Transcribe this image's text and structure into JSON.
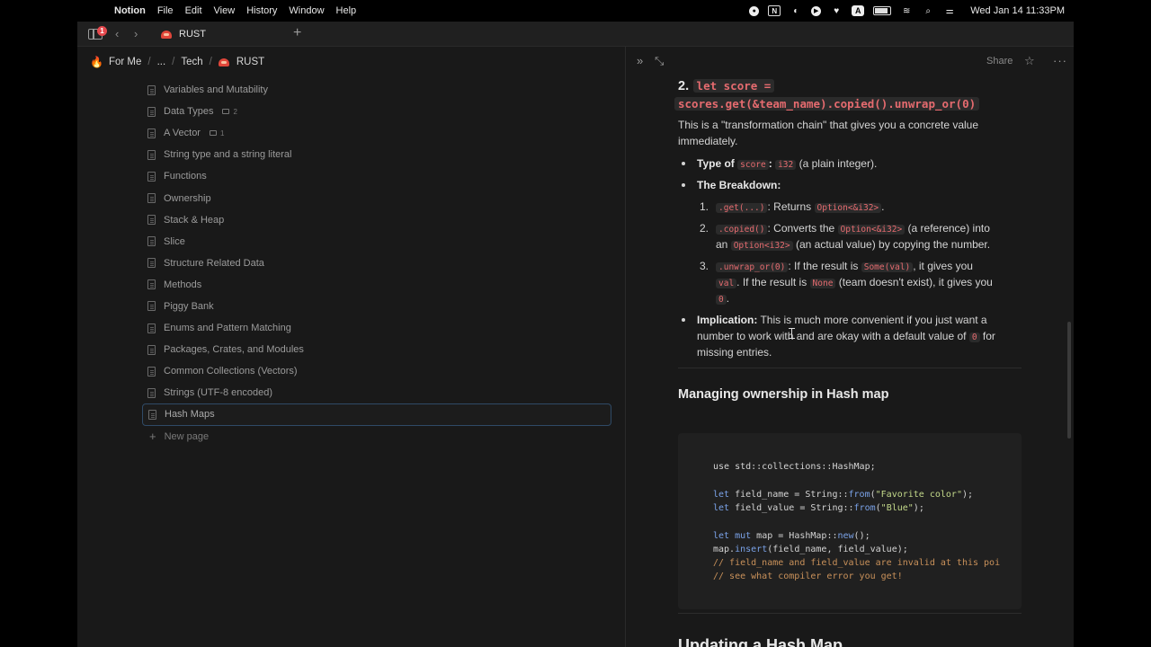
{
  "menubar": {
    "app_name": "Notion",
    "items": [
      "File",
      "Edit",
      "View",
      "History",
      "Window",
      "Help"
    ],
    "clock": "Wed Jan 14  11:33PM",
    "status_icons": [
      "record-icon",
      "notion-icon",
      "half-circle-icon",
      "play-icon",
      "heart-icon",
      "a-icon",
      "battery-icon",
      "wifi-icon",
      "search-icon",
      "control-center-icon"
    ]
  },
  "tabbar": {
    "notification_count": "1",
    "tab_title": "RUST"
  },
  "breadcrumb": {
    "items": [
      "For Me",
      "...",
      "Tech",
      "RUST"
    ]
  },
  "sidebar_pages": [
    {
      "title": "Variables and Mutability"
    },
    {
      "title": "Data Types",
      "comments": "2"
    },
    {
      "title": "A Vector",
      "comments": "1"
    },
    {
      "title": "String type and a string literal"
    },
    {
      "title": "Functions"
    },
    {
      "title": "Ownership"
    },
    {
      "title": "Stack & Heap"
    },
    {
      "title": "Slice"
    },
    {
      "title": "Structure Related Data"
    },
    {
      "title": "Methods"
    },
    {
      "title": "Piggy Bank"
    },
    {
      "title": "Enums and Pattern Matching"
    },
    {
      "title": "Packages, Crates, and Modules"
    },
    {
      "title": "Common Collections (Vectors)"
    },
    {
      "title": "Strings (UTF-8 encoded)"
    },
    {
      "title": "Hash Maps",
      "selected": true
    }
  ],
  "new_page_label": "New page",
  "right_toolbar": {
    "share_label": "Share"
  },
  "doc": {
    "heading_num": "2.",
    "heading_code_1": "let score =",
    "heading_code_2": "scores.get(&team_name).copied().unwrap_or(0)",
    "intro": "This is a \"transformation chain\" that gives you a concrete value immediately.",
    "type_label": "Type of",
    "type_var": "score",
    "type_colon": ":",
    "type_code": "i32",
    "type_desc": "(a plain integer).",
    "breakdown_label": "The Breakdown:",
    "step1_code": ".get(...)",
    "step1_text": ": Returns",
    "step1_code2": "Option<&i32>",
    "step1_end": ".",
    "step2_code": ".copied()",
    "step2_text": ": Converts the",
    "step2_code2": "Option<&i32>",
    "step2_text2": "(a reference) into",
    "step2_text3": "an",
    "step2_code3": "Option<i32>",
    "step2_text4": "(an actual value) by copying the number.",
    "step3_code": ".unwrap_or(0)",
    "step3_text": ": If the result is",
    "step3_code2": "Some(val)",
    "step3_text2": ", it gives you",
    "step3_code3": "val",
    "step3_text3": ". If the result is",
    "step3_code4": "None",
    "step3_text4": "(team doesn't exist), it gives you",
    "step3_code5": "0",
    "step3_end": ".",
    "impl_label": "Implication:",
    "impl_text1": "This is much more convenient if you just want a",
    "impl_text2": "number to work with and are okay with a default value of",
    "impl_code": "0",
    "impl_text3": "for",
    "impl_text4": "missing entries.",
    "section_heading": "Managing ownership in Hash map",
    "code_lines": [
      "use std::collections::HashMap;",
      "",
      "let field_name = String::from(\"Favorite color\");",
      "let field_value = String::from(\"Blue\");",
      "",
      "let mut map = HashMap::new();",
      "map.insert(field_name, field_value);",
      "// field_name and field_value are invalid at this poi",
      "// see what compiler error you get!"
    ],
    "next_heading": "Updating a Hash Map"
  }
}
